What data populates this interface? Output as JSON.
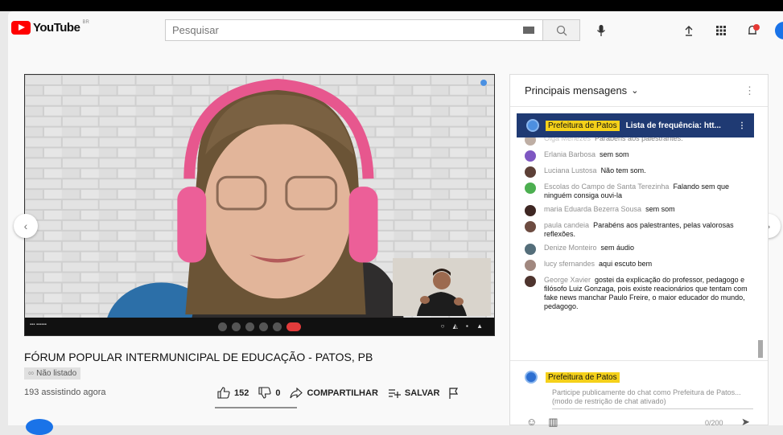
{
  "header": {
    "logo_text": "YouTube",
    "country_code": "BR",
    "search_placeholder": "Pesquisar"
  },
  "video": {
    "title": "FÓRUM POPULAR INTERMUNICIPAL DE EDUCAÇÃO - PATOS, PB",
    "unlisted_label": "Não listado",
    "viewers": "193 assistindo agora",
    "likes": "152",
    "dislikes": "0",
    "share_label": "COMPARTILHAR",
    "save_label": "SALVAR"
  },
  "chat": {
    "header_label": "Principais mensagens",
    "pinned": {
      "author": "Prefeitura de Patos",
      "text": "Lista de frequência: htt..."
    },
    "messages": [
      {
        "author": "Olga Menezes",
        "text": "Parabéns aos palestrantes.",
        "color": "#8a6d5a"
      },
      {
        "author": "Erlania Barbosa",
        "text": "sem som",
        "color": "#7e57c2"
      },
      {
        "author": "Luciana Lustosa",
        "text": "Não tem som.",
        "color": "#5d4037"
      },
      {
        "author": "Escolas do Campo de Santa Terezinha",
        "text": "Falando sem que ninguém consiga ouvi-la",
        "color": "#4caf50"
      },
      {
        "author": "maria Eduarda Bezerra Sousa",
        "text": "sem som",
        "color": "#3e2723"
      },
      {
        "author": "paula candeia",
        "text": "Parabéns aos palestrantes, pelas valorosas reflexões.",
        "color": "#6d4c41"
      },
      {
        "author": "Denize Monteiro",
        "text": "sem áudio",
        "color": "#546e7a"
      },
      {
        "author": "lucy sfernandes",
        "text": "aqui escuto bem",
        "color": "#a1887f"
      },
      {
        "author": "George Xavier",
        "text": "gostei da explicação do professor, pedagogo e filósofo Luiz Gonzaga, pois existe reacionários que tentam com fake news manchar Paulo Freire, o maior educador do mundo, pedagogo.",
        "color": "#4e342e"
      }
    ],
    "footer": {
      "author": "Prefeitura de Patos",
      "placeholder": "Participe publicamente do chat como Prefeitura de Patos... (modo de restrição de chat ativado)",
      "counter": "0/200"
    }
  },
  "colors": {
    "brand_red": "#ff0000",
    "pinned_bg": "#1f3a73",
    "highlight": "#f5d11a"
  }
}
